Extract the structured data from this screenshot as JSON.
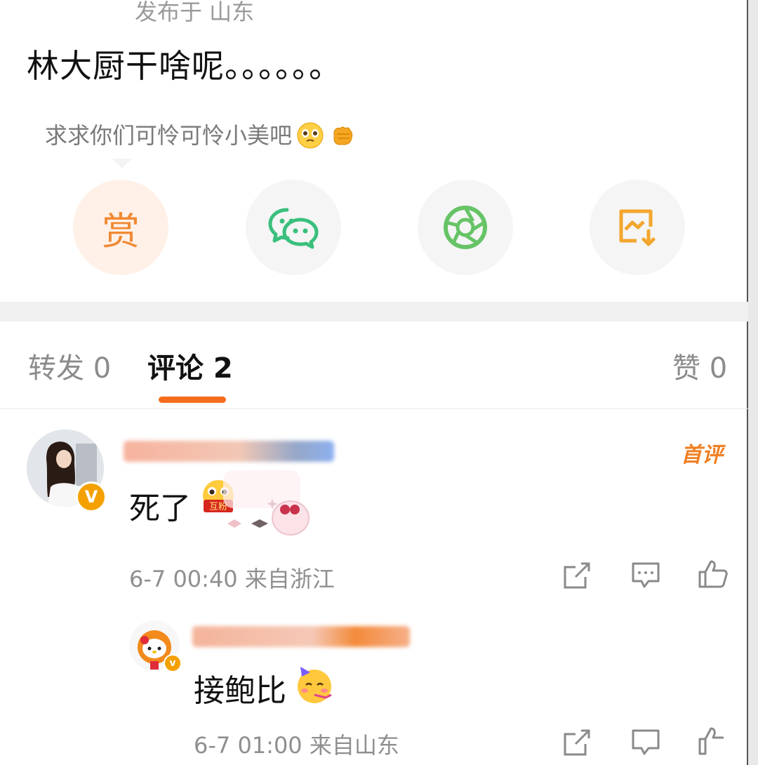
{
  "post": {
    "location": "发布于 山东",
    "text": "林大厨干啥呢。。。。。。",
    "reward_tip": "求求你们可怜可怜小美吧"
  },
  "actions": {
    "reward_label": "赏"
  },
  "tabs": [
    {
      "label": "转发 0"
    },
    {
      "label": "评论 2"
    },
    {
      "label": "赞 0"
    }
  ],
  "comments": [
    {
      "text": "死了",
      "meta": "6-7 00:40 来自浙江",
      "badge": "首评",
      "sticker_text": "互粉"
    },
    {
      "text": "接鲍比",
      "meta": "6-7 01:00 来自山东"
    }
  ],
  "colors": {
    "accent": "#f46d1d",
    "reward_orange": "#f08a34",
    "wechat_green": "#39c07c",
    "moments_green": "#66c466",
    "download_orange": "#f2a72e"
  }
}
